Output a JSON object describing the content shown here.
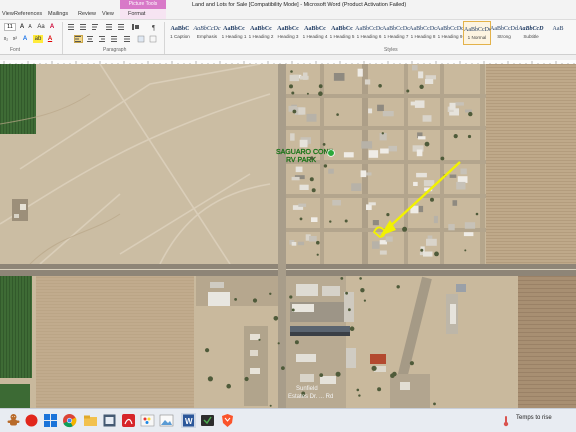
{
  "window": {
    "title": "Land and Lots for Sale [Compatibility Mode] - Microsoft Word (Product Activation Failed)",
    "contextual_group": "Picture Tools"
  },
  "tabs": [
    {
      "label": "View"
    },
    {
      "label": "References"
    },
    {
      "label": "Mailings"
    },
    {
      "label": "Review"
    },
    {
      "label": "View"
    },
    {
      "label": "Format"
    }
  ],
  "ribbon": {
    "font_size": "11",
    "groups": {
      "font": "Font",
      "paragraph": "Paragraph",
      "styles": "Styles"
    },
    "styles": [
      {
        "preview": "AaBbC",
        "name": "1 Caption"
      },
      {
        "preview": "AaBbCcDc",
        "name": "Emphasis"
      },
      {
        "preview": "AaBbCc",
        "name": "1 Heading 1"
      },
      {
        "preview": "AaBbCc",
        "name": "1 Heading 2"
      },
      {
        "preview": "AaBbCc",
        "name": "Heading 3"
      },
      {
        "preview": "AaBbCc",
        "name": "1 Heading 4"
      },
      {
        "preview": "AaBbCc",
        "name": "1 Heading 5"
      },
      {
        "preview": "AaBbCcDc",
        "name": "1 Heading 6"
      },
      {
        "preview": "AaBbCcDc",
        "name": "1 Heading 7"
      },
      {
        "preview": "AaBbCcDc",
        "name": "1 Heading 8"
      },
      {
        "preview": "AaBbCcDc",
        "name": "1 Heading 9"
      },
      {
        "preview": "AaBbCcDc",
        "name": "1 Normal"
      },
      {
        "preview": "AaBbCcDd",
        "name": "Strong"
      },
      {
        "preview": "AaBbCcD",
        "name": "Subtitle"
      },
      {
        "preview": "AaB",
        "name": ""
      }
    ],
    "active_style": "1 Normal"
  },
  "image": {
    "label_line1": "SAGUARO CONE",
    "label_line2": "RV PARK",
    "bottom_label_line1": "Sunfield",
    "bottom_label_line2": "Estates Dr. ... Rd"
  },
  "taskbar": {
    "weather_text": "Temps to rise",
    "apps": [
      "gingerbread-app",
      "record-app",
      "windows-start",
      "search",
      "chrome",
      "file-explorer",
      "acrobat",
      "paint",
      "word",
      "vpn",
      "photos",
      "brave"
    ]
  },
  "colors": {
    "accent_picture_tools": "#d879c8",
    "annotation_arrow": "#f2f200",
    "desert": "#c7b79c",
    "field_green": "#3e6b35"
  }
}
